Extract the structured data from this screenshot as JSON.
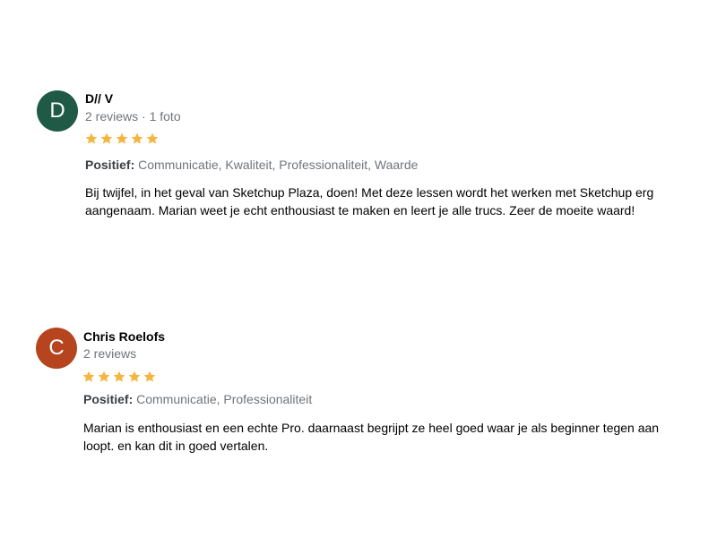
{
  "reviews": [
    {
      "avatar_letter": "D",
      "avatar_color": "#1e5a46",
      "name": "D// V",
      "meta": "2 reviews · 1 foto",
      "rating": 5,
      "positive_label": "Positief:",
      "positive_values": "Communicatie, Kwaliteit, Professionaliteit, Waarde",
      "text": "Bij twijfel, in het geval van Sketchup Plaza, doen! Met deze lessen wordt het werken met Sketchup erg aangenaam. Marian weet je echt enthousiast te maken en leert je alle trucs. Zeer de moeite waard!"
    },
    {
      "avatar_letter": "C",
      "avatar_color": "#b5441f",
      "name": "Chris Roelofs",
      "meta": "2 reviews",
      "rating": 5,
      "positive_label": "Positief:",
      "positive_values": "Communicatie, Professionaliteit",
      "text": "Marian is enthousiast en een echte Pro. daarnaast begrijpt ze heel goed waar je als beginner tegen aan loopt. en kan dit in goed vertalen."
    }
  ],
  "star_color": "#f4b63f"
}
